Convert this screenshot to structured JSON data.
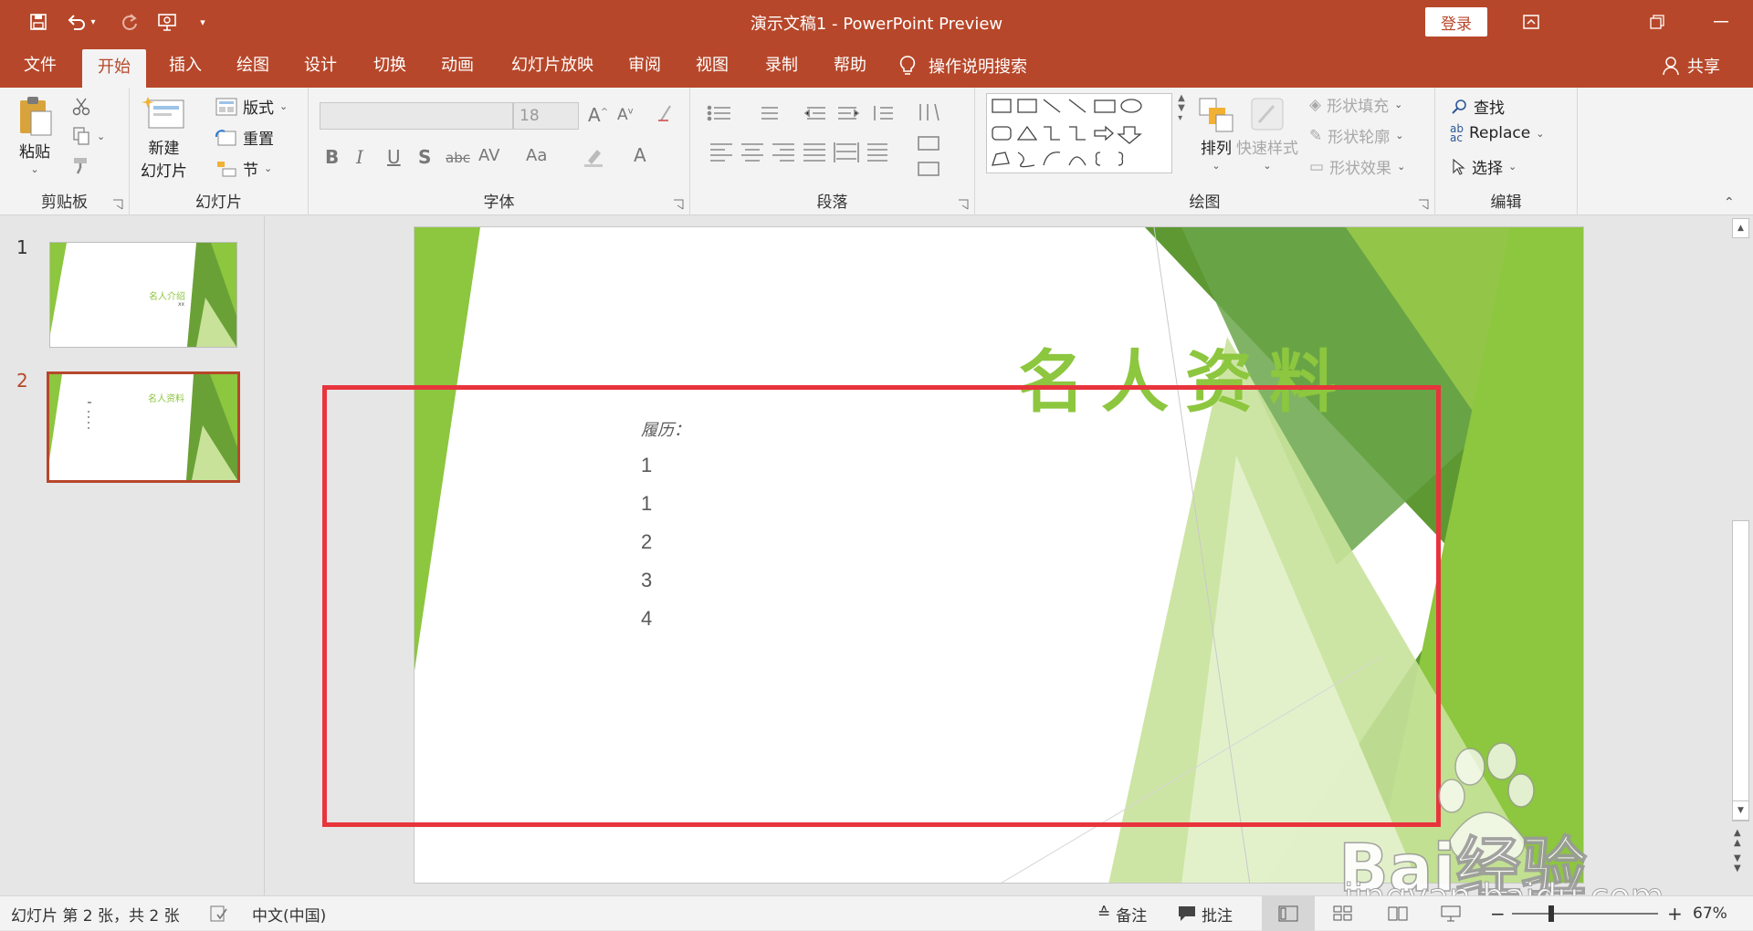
{
  "titlebar": {
    "document_title": "演示文稿1  -  PowerPoint Preview",
    "login_label": "登录",
    "icons": [
      "save-icon",
      "undo-icon",
      "redo-icon",
      "present-from-start-icon",
      "customize-qat-icon",
      "ribbon-display-icon",
      "restore-icon",
      "minimize-icon"
    ]
  },
  "tabs": [
    "文件",
    "开始",
    "插入",
    "绘图",
    "设计",
    "切换",
    "动画",
    "幻灯片放映",
    "审阅",
    "视图",
    "录制",
    "帮助"
  ],
  "active_tab": "开始",
  "tell_me": "操作说明搜索",
  "share_label": "共享",
  "ribbon": {
    "clipboard": {
      "paste_label": "粘贴",
      "group_label": "剪贴板"
    },
    "slides": {
      "new_slide_line1": "新建",
      "new_slide_line2": "幻灯片",
      "layout_label": "版式",
      "reset_label": "重置",
      "section_label": "节",
      "group_label": "幻灯片"
    },
    "font": {
      "font_name_value": "",
      "font_size_value": "18",
      "group_label": "字体",
      "buttons": [
        "B",
        "I",
        "U",
        "S",
        "abc",
        "AV",
        "Aa"
      ]
    },
    "paragraph": {
      "group_label": "段落"
    },
    "drawing": {
      "arrange_label": "排列",
      "quick_styles_label": "快速样式",
      "shape_fill_label": "形状填充",
      "shape_outline_label": "形状轮廓",
      "shape_effects_label": "形状效果",
      "group_label": "绘图"
    },
    "editing": {
      "find_label": "查找",
      "replace_label": "Replace",
      "select_label": "选择",
      "group_label": "编辑"
    }
  },
  "slides_pane": {
    "slides": [
      {
        "number": "1",
        "title": "名人介绍",
        "subtitle": "xx"
      },
      {
        "number": "2",
        "title": "名人资料",
        "selected": true
      }
    ]
  },
  "slide": {
    "title": "名人资料",
    "body_heading": "履历：",
    "body_lines": [
      "1",
      "1",
      "2",
      "3",
      "4"
    ]
  },
  "statusbar": {
    "slide_info": "幻灯片 第 2 张，共 2 张",
    "language": "中文(中国)",
    "notes_label": "备注",
    "comments_label": "批注",
    "zoom": "67%"
  },
  "colors": {
    "accent": "#b7472a",
    "slide_green": "#8dc63f",
    "highlight_red": "#e8343c"
  },
  "watermark": {
    "brand": "Bai经验",
    "url": "jingyan.baidu.com"
  }
}
